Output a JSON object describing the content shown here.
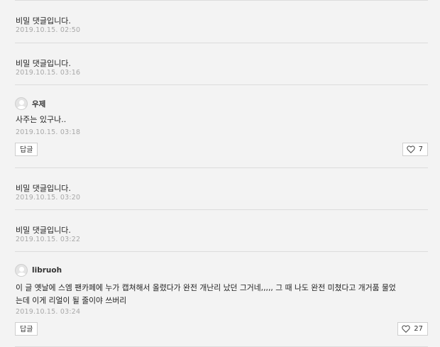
{
  "comments": [
    {
      "type": "secret",
      "text": "비밀 댓글입니다.",
      "date": "2019.10.15. 02:50"
    },
    {
      "type": "secret",
      "text": "비밀 댓글입니다.",
      "date": "2019.10.15. 03:16"
    },
    {
      "type": "full",
      "author": "우제",
      "text": "사주는 있구나..",
      "date": "2019.10.15. 03:18",
      "reply_label": "답글",
      "likes": "7"
    },
    {
      "type": "secret",
      "text": "비밀 댓글입니다.",
      "date": "2019.10.15. 03:20"
    },
    {
      "type": "secret",
      "text": "비밀 댓글입니다.",
      "date": "2019.10.15. 03:22"
    },
    {
      "type": "full",
      "author": "libruoh",
      "text_lines": [
        "이 글 옛날에 스엠 팬카페에 누가 캡쳐해서 올렸다가 완전 개난리 났던 그거네,,,,, 그 때 나도 완전 미쳤다고 개거품 물었",
        "는데 이게 리얼이 될 줄이야 쓰버리"
      ],
      "date": "2019.10.15. 03:24",
      "reply_label": "답글",
      "likes": "27"
    }
  ],
  "icons": {
    "avatar": "default-user-avatar-icon",
    "like": "heart-outline-icon"
  }
}
